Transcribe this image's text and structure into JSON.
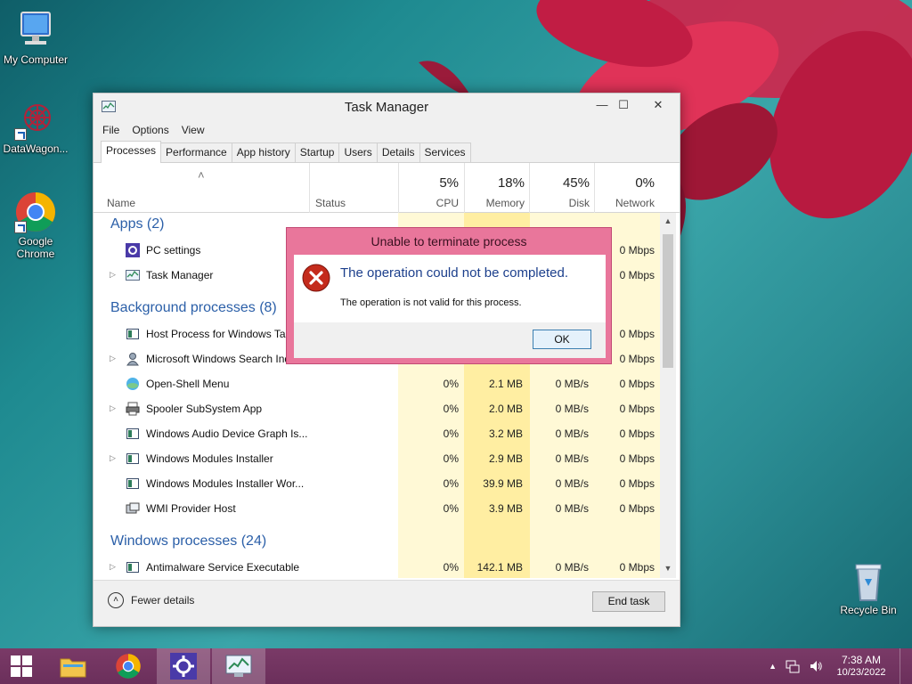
{
  "desktop": {
    "icons": [
      {
        "label": "My Computer"
      },
      {
        "label": "DataWagon..."
      },
      {
        "label": "Google Chrome"
      },
      {
        "label": "Recycle Bin"
      }
    ]
  },
  "window": {
    "title": "Task Manager",
    "buttons": {
      "minimize": "—",
      "maximize": "☐",
      "close": "✕"
    },
    "menu": [
      "File",
      "Options",
      "View"
    ],
    "tabs": [
      "Processes",
      "Performance",
      "App history",
      "Startup",
      "Users",
      "Details",
      "Services"
    ],
    "active_tab": "Processes",
    "sort_indicator": "˄",
    "columns": {
      "name": "Name",
      "status": "Status",
      "cpu": {
        "pct": "5%",
        "label": "CPU"
      },
      "memory": {
        "pct": "18%",
        "label": "Memory"
      },
      "disk": {
        "pct": "45%",
        "label": "Disk"
      },
      "network": {
        "pct": "0%",
        "label": "Network"
      }
    },
    "groups": {
      "apps": "Apps (2)",
      "background": "Background processes (8)",
      "windows": "Windows processes (24)"
    },
    "rows": [
      {
        "name": "PC settings",
        "cpu": "",
        "mem": "",
        "disk": "",
        "net": "0 Mbps"
      },
      {
        "name": "Task Manager",
        "cpu": "",
        "mem": "",
        "disk": "",
        "net": "0 Mbps"
      },
      {
        "name": "Host Process for Windows Tasks",
        "cpu": "",
        "mem": "",
        "disk": "",
        "net": "0 Mbps"
      },
      {
        "name": "Microsoft Windows Search Indexer",
        "cpu": "",
        "mem": "",
        "disk": "",
        "net": "0 Mbps"
      },
      {
        "name": "Open-Shell Menu",
        "cpu": "0%",
        "mem": "2.1 MB",
        "disk": "0 MB/s",
        "net": "0 Mbps"
      },
      {
        "name": "Spooler SubSystem App",
        "cpu": "0%",
        "mem": "2.0 MB",
        "disk": "0 MB/s",
        "net": "0 Mbps"
      },
      {
        "name": "Windows Audio Device Graph Is...",
        "cpu": "0%",
        "mem": "3.2 MB",
        "disk": "0 MB/s",
        "net": "0 Mbps"
      },
      {
        "name": "Windows Modules Installer",
        "cpu": "0%",
        "mem": "2.9 MB",
        "disk": "0 MB/s",
        "net": "0 Mbps"
      },
      {
        "name": "Windows Modules Installer Wor...",
        "cpu": "0%",
        "mem": "39.9 MB",
        "disk": "0 MB/s",
        "net": "0 Mbps"
      },
      {
        "name": "WMI Provider Host",
        "cpu": "0%",
        "mem": "3.9 MB",
        "disk": "0 MB/s",
        "net": "0 Mbps"
      },
      {
        "name": "Antimalware Service Executable",
        "cpu": "0%",
        "mem": "142.1 MB",
        "disk": "0 MB/s",
        "net": "0 Mbps"
      }
    ],
    "footer": {
      "fewer_details": "Fewer details",
      "end_task": "End task"
    }
  },
  "dialog": {
    "title": "Unable to terminate process",
    "main": "The operation could not be completed.",
    "sub": "The operation is not valid for this process.",
    "ok": "OK"
  },
  "taskbar": {
    "time": "7:38 AM",
    "date": "10/23/2022"
  },
  "colors": {
    "accent_heading": "#2b5fa8",
    "dialog_frame": "#e9769b",
    "taskbar": "#6b2f5b",
    "heat_light": "#fff9d6",
    "heat_medium": "#ffeea2"
  }
}
